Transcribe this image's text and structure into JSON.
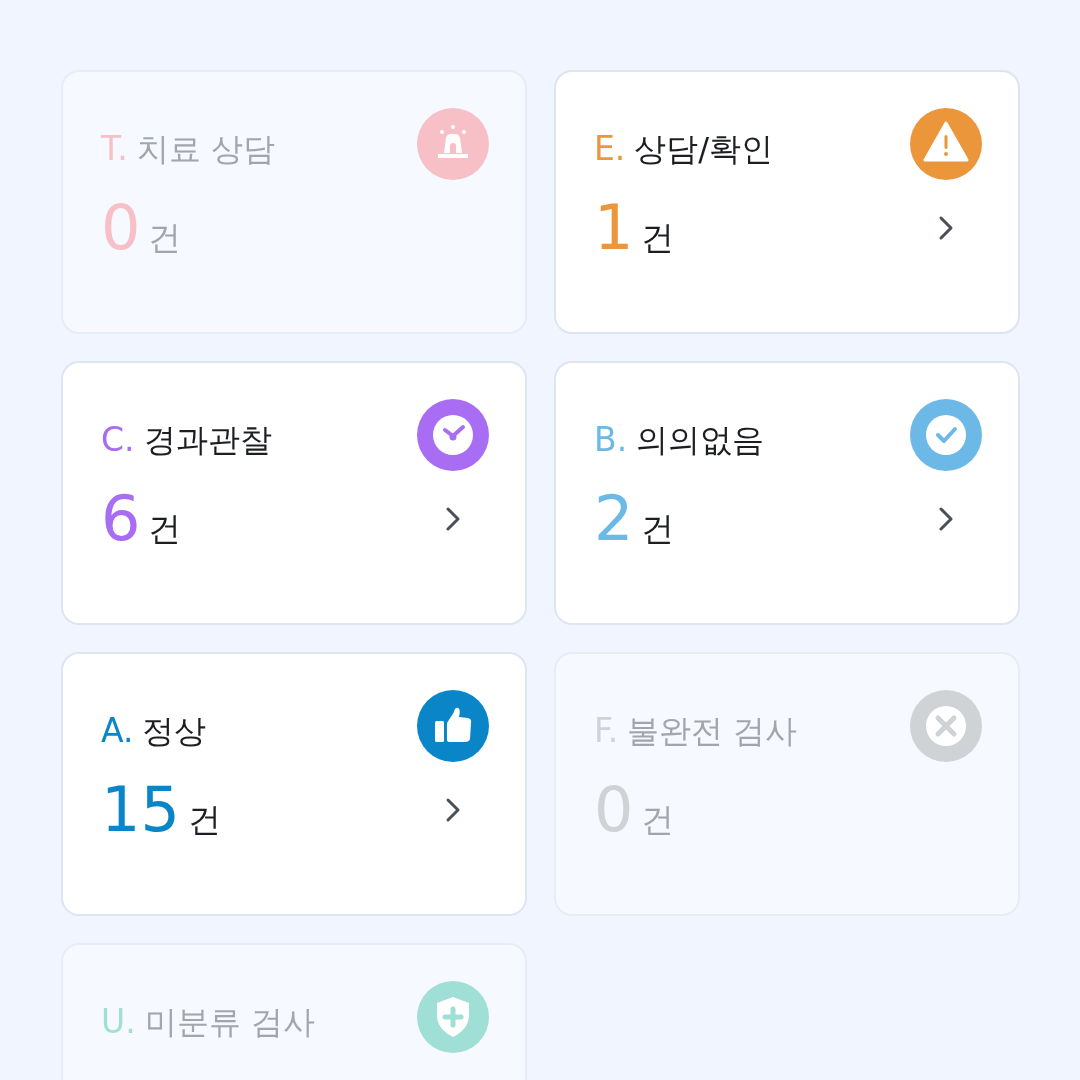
{
  "cards": [
    {
      "letter": "T.",
      "title": "치료 상담",
      "count": "0",
      "unit": "건",
      "color": "#f7c0c6",
      "kind": "siren",
      "disabled": true
    },
    {
      "letter": "E.",
      "title": "상담/확인",
      "count": "1",
      "unit": "건",
      "color": "#ec963b",
      "kind": "warning",
      "disabled": false
    },
    {
      "letter": "C.",
      "title": "경과관찰",
      "count": "6",
      "unit": "건",
      "color": "#a86df2",
      "kind": "clock",
      "disabled": false
    },
    {
      "letter": "B.",
      "title": "의의없음",
      "count": "2",
      "unit": "건",
      "color": "#6cb9e8",
      "kind": "check",
      "disabled": false
    },
    {
      "letter": "A.",
      "title": "정상",
      "count": "15",
      "unit": "건",
      "color": "#0a86c8",
      "kind": "thumb",
      "disabled": false
    },
    {
      "letter": "F.",
      "title": "불완전 검사",
      "count": "0",
      "unit": "건",
      "color": "#cfd3d6",
      "kind": "cross",
      "disabled": true
    },
    {
      "letter": "U.",
      "title": "미분류 검사",
      "color": "#9fdfd5",
      "kind": "shield",
      "disabled": true
    }
  ]
}
